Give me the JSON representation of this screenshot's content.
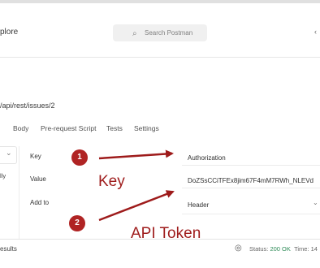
{
  "header": {
    "explore_label": "plore",
    "search_placeholder": "Search Postman",
    "right_glyph": "‹"
  },
  "request": {
    "url": "/api/rest/issues/2"
  },
  "tabs": [
    {
      "label": "Body"
    },
    {
      "label": "Pre-request Script"
    },
    {
      "label": "Tests"
    },
    {
      "label": "Settings"
    }
  ],
  "auth": {
    "left_fragment": "lly",
    "key_label": "Key",
    "key_value": "Authorization",
    "value_label": "Value",
    "value_value": "DoZSsCCiTFEx8jim67F4mM7RWh_NLEVd",
    "add_to_label": "Add to",
    "add_to_value": "Header"
  },
  "annotations": {
    "badge1": "1",
    "badge2": "2",
    "key_text": "Key",
    "token_text": "API Token",
    "accent_color": "#9e1b1b"
  },
  "footer": {
    "results_label": "esults",
    "status_label": "Status:",
    "status_value": "200 OK",
    "time_label": "Time: 14"
  }
}
